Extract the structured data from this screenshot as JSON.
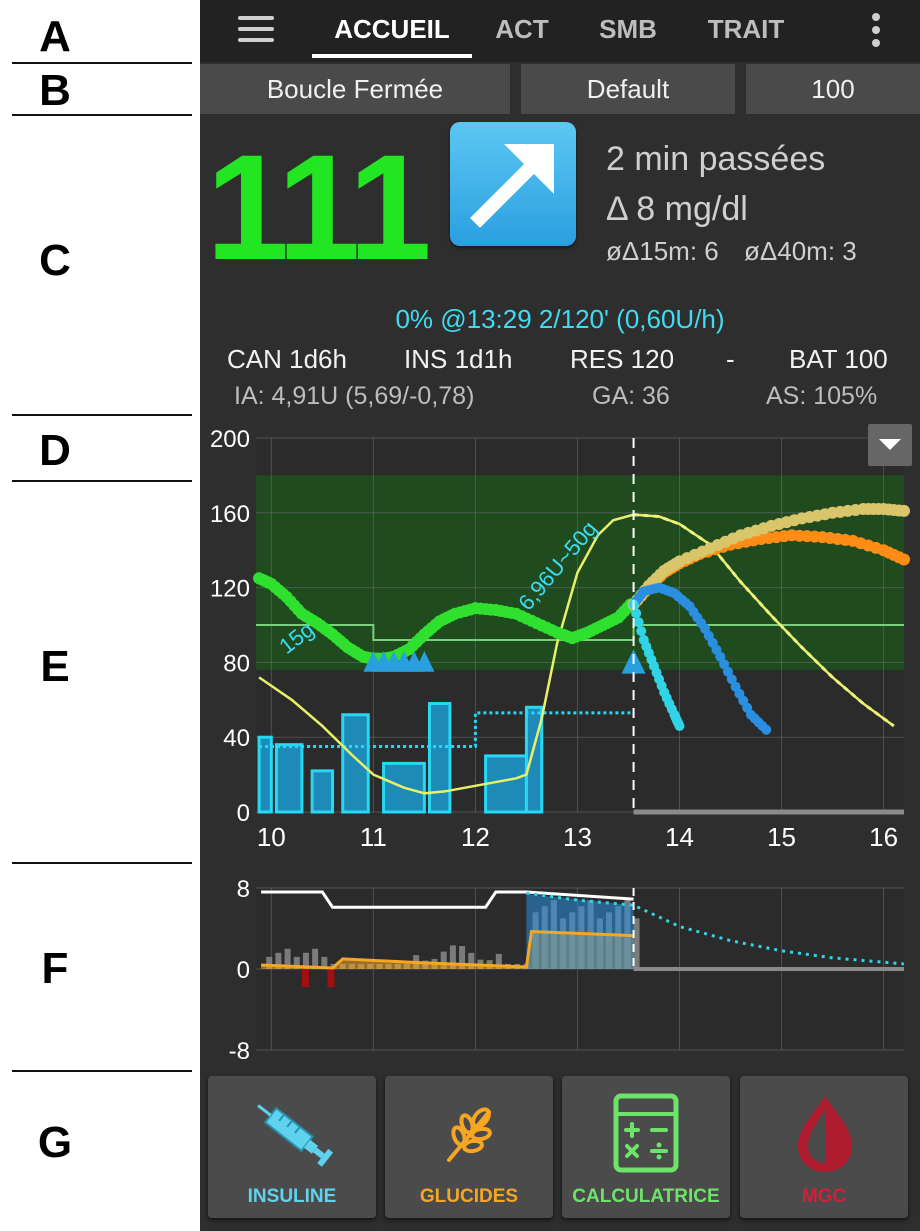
{
  "annotations": [
    "A",
    "B",
    "C",
    "D",
    "E",
    "F",
    "G"
  ],
  "tabs": [
    "ACCUEIL",
    "ACT",
    "SMB",
    "TRAIT"
  ],
  "active_tab": "ACCUEIL",
  "mode": {
    "loop": "Boucle Fermée",
    "profile": "Default",
    "percent": "100"
  },
  "bg": {
    "value": "111",
    "trend": "arrow-up-right-icon",
    "ago": "2 min passées",
    "delta": "Δ 8 mg/dl",
    "avg15": "øΔ15m: 6",
    "avg40": "øΔ40m: 3",
    "color": "#22e622"
  },
  "temp_basal": "0% @13:29 2/120' (0,60U/h)",
  "status": {
    "can": "CAN 1d6h",
    "ins": "INS 1d1h",
    "res": "RES 120",
    "dash": "-",
    "bat": "BAT 100",
    "iob": "IA: 4,91U (5,69/-0,78)",
    "cob": "GA: 36",
    "sens": "AS: 105%"
  },
  "main_chart": {
    "y_ticks": [
      "200",
      "160",
      "120",
      "80",
      "40",
      "0"
    ],
    "x_ticks": [
      "10",
      "11",
      "12",
      "13",
      "14",
      "15",
      "16"
    ],
    "annotations": [
      "15g",
      "6,96U~50g"
    ]
  },
  "iob_chart": {
    "y_ticks": [
      "8",
      "0",
      "-8"
    ]
  },
  "actions": [
    {
      "label": "INSULINE",
      "icon": "syringe-icon",
      "color": "#5fd3ee"
    },
    {
      "label": "GLUCIDES",
      "icon": "wheat-icon",
      "color": "#f5a623"
    },
    {
      "label": "CALCULATRICE",
      "icon": "calculator-icon",
      "color": "#6ee36a"
    },
    {
      "label": "MGC",
      "icon": "blood-drop-icon",
      "color": "#d0203a"
    }
  ],
  "chart_data": [
    {
      "type": "line",
      "title": "",
      "xlabel": "",
      "ylabel": "",
      "xlim": [
        9.85,
        16.2
      ],
      "ylim": [
        0,
        200
      ],
      "target_range": [
        76,
        180
      ],
      "now": 13.55,
      "series": [
        {
          "x": [
            9.88,
            10.0,
            10.15,
            10.3,
            10.45,
            10.6,
            10.75,
            10.9,
            11.0,
            11.1,
            11.2,
            11.35,
            11.5,
            11.65,
            11.8,
            12.0,
            12.2,
            12.4,
            12.6,
            12.8,
            12.95,
            13.1,
            13.25,
            13.4,
            13.52
          ],
          "y": [
            125,
            122,
            115,
            106,
            101,
            95,
            88,
            83,
            82,
            82,
            83,
            87,
            95,
            102,
            106,
            109,
            108,
            106,
            101,
            96,
            93,
            96,
            100,
            104,
            111
          ]
        },
        {
          "x": [
            9.88,
            10.2,
            10.5,
            10.8,
            11.0,
            11.3,
            11.5,
            11.7,
            12.0,
            12.2,
            12.4,
            12.5,
            12.65,
            12.8,
            13.0,
            13.2,
            13.35,
            13.55,
            13.8,
            14.0,
            14.3,
            14.6,
            14.9,
            15.2,
            15.5,
            15.8,
            16.1
          ],
          "y": [
            72,
            60,
            46,
            30,
            20,
            13,
            10,
            11,
            14,
            16,
            18,
            20,
            50,
            90,
            128,
            148,
            156,
            159,
            158,
            154,
            143,
            123,
            105,
            88,
            72,
            58,
            46
          ]
        },
        {
          "x": [
            13.55,
            13.7,
            13.85,
            14.0,
            14.2,
            14.5,
            14.8,
            15.1,
            15.4,
            15.7,
            16.0,
            16.2
          ],
          "y": [
            111,
            120,
            128,
            133,
            138,
            143,
            146,
            148,
            147,
            145,
            140,
            135
          ]
        },
        {
          "x": [
            13.55,
            13.7,
            13.85,
            14.0,
            14.3,
            14.6,
            14.9,
            15.2,
            15.5,
            15.8,
            16.0,
            16.2
          ],
          "y": [
            111,
            121,
            129,
            134,
            141,
            148,
            153,
            157,
            160,
            162,
            162,
            161
          ]
        },
        {
          "x": [
            13.55,
            13.65,
            13.8,
            13.95,
            14.1,
            14.25,
            14.4,
            14.55,
            14.7,
            14.85
          ],
          "y": [
            111,
            118,
            120,
            117,
            110,
            98,
            83,
            67,
            52,
            44
          ]
        },
        {
          "x": [
            13.55,
            13.65,
            13.75,
            13.85,
            13.95,
            14.0
          ],
          "y": [
            111,
            92,
            78,
            64,
            52,
            46
          ]
        }
      ]
    },
    {
      "type": "line",
      "title": "",
      "xlabel": "",
      "ylabel": "",
      "xlim": [
        9.85,
        16.2
      ],
      "ylim": [
        -8,
        8
      ],
      "series": [
        {
          "x": [
            9.9,
            10.5,
            10.6,
            12.1,
            12.2,
            12.5,
            13.55
          ],
          "y": [
            7.6,
            7.6,
            6.1,
            6.1,
            7.6,
            7.6,
            6.9
          ]
        },
        {
          "x": [
            12.5,
            13.0,
            13.55,
            14.0,
            14.5,
            15.0,
            15.5,
            16.2
          ],
          "y": [
            7.5,
            6.8,
            6.3,
            4.2,
            2.8,
            1.8,
            1.1,
            0.5
          ]
        },
        {
          "x": [
            9.9,
            10.6,
            10.7,
            11.5,
            12.5,
            12.55,
            13.55
          ],
          "y": [
            0.4,
            0.1,
            1.0,
            0.6,
            0.2,
            3.7,
            3.3
          ]
        }
      ]
    }
  ]
}
